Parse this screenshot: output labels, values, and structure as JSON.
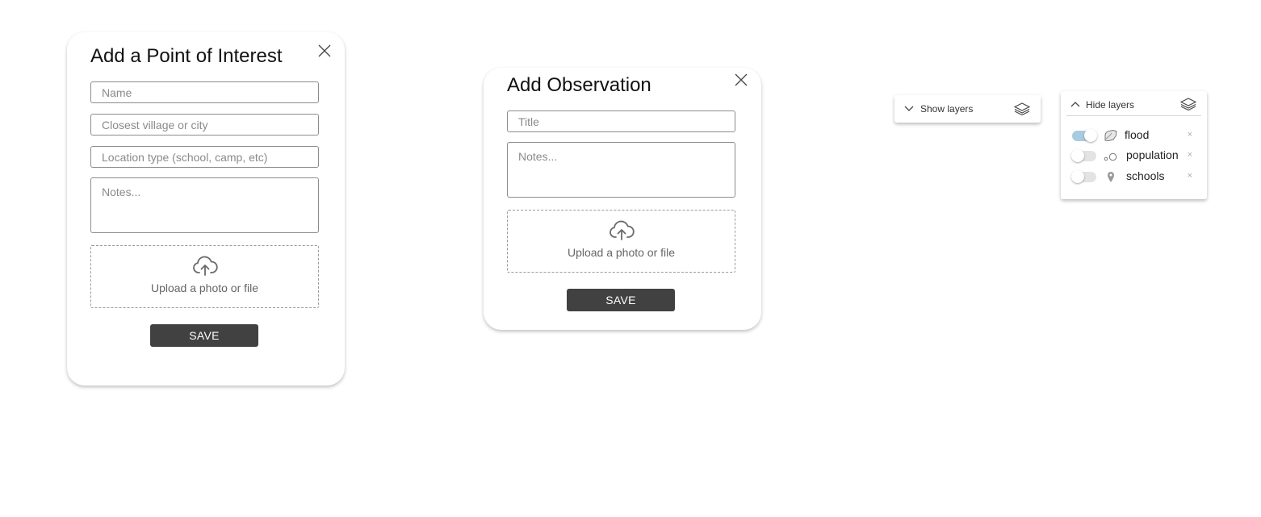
{
  "poi_dialog": {
    "title": "Add a Point of Interest",
    "name_placeholder": "Name",
    "village_placeholder": "Closest village or city",
    "location_type_placeholder": "Location type (school, camp, etc)",
    "notes_placeholder": "Notes...",
    "upload_label": "Upload a photo or file",
    "save_label": "SAVE"
  },
  "observation_dialog": {
    "title": "Add Observation",
    "title_placeholder": "Title",
    "notes_placeholder": "Notes...",
    "upload_label": "Upload a photo or file",
    "save_label": "SAVE"
  },
  "layers_collapsed": {
    "toggle_label": "Show layers"
  },
  "layers_expanded": {
    "toggle_label": "Hide layers",
    "layers": [
      {
        "name": "flood",
        "enabled": true,
        "icon": "flood-area-icon",
        "remove": "×"
      },
      {
        "name": "population",
        "enabled": false,
        "icon": "population-circles-icon",
        "remove": "×"
      },
      {
        "name": "schools",
        "enabled": false,
        "icon": "map-pin-icon",
        "remove": "×"
      }
    ]
  },
  "colors": {
    "save_button": "#414141",
    "toggle_on": "#a9cbdf",
    "toggle_off": "#e3e3e3"
  }
}
